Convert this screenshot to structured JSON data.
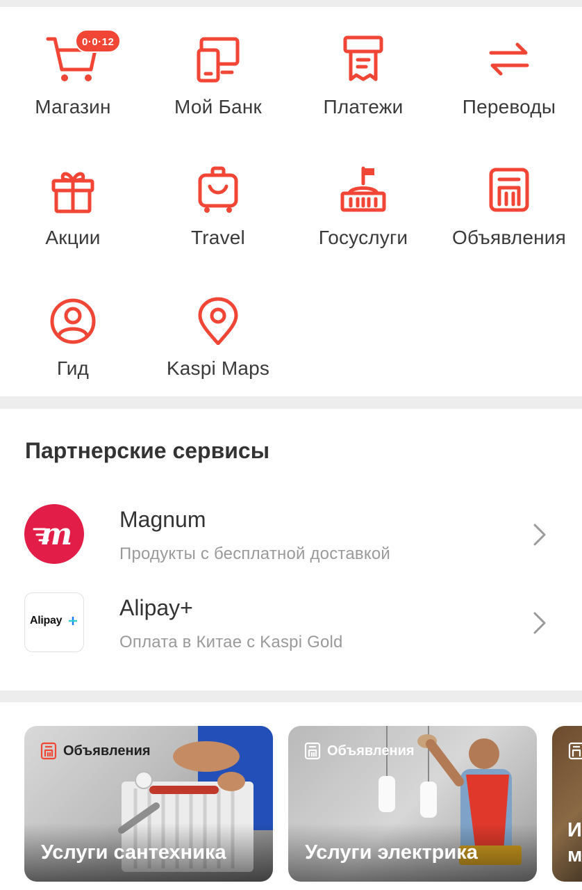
{
  "services": [
    {
      "label": "Магазин",
      "icon": "cart-icon",
      "badge": "0·0·12"
    },
    {
      "label": "Мой Банк",
      "icon": "phone-card-icon"
    },
    {
      "label": "Платежи",
      "icon": "receipt-icon"
    },
    {
      "label": "Переводы",
      "icon": "transfer-arrows-icon"
    },
    {
      "label": "Акции",
      "icon": "gift-icon"
    },
    {
      "label": "Travel",
      "icon": "suitcase-icon"
    },
    {
      "label": "Госуслуги",
      "icon": "government-building-icon"
    },
    {
      "label": "Объявления",
      "icon": "classifieds-icon"
    },
    {
      "label": "Гид",
      "icon": "user-circle-icon"
    },
    {
      "label": "Kaspi Maps",
      "icon": "map-pin-icon"
    }
  ],
  "partners": {
    "title": "Партнерские сервисы",
    "items": [
      {
        "name": "Magnum",
        "description": "Продукты с бесплатной доставкой",
        "logo": "magnum-logo"
      },
      {
        "name": "Alipay+",
        "description": "Оплата в Китае с Kaspi Gold",
        "logo": "alipay-logo",
        "logo_text": "Alipay"
      }
    ]
  },
  "ads": [
    {
      "tag": "Объявления",
      "title": "Услуги сантехника"
    },
    {
      "tag": "Объявления",
      "title": "Услуги электрика"
    },
    {
      "tag": "",
      "title": "И м"
    }
  ],
  "colors": {
    "accent": "#f14635",
    "magnum": "#e11d48",
    "alipay_blue": "#1677ff"
  }
}
